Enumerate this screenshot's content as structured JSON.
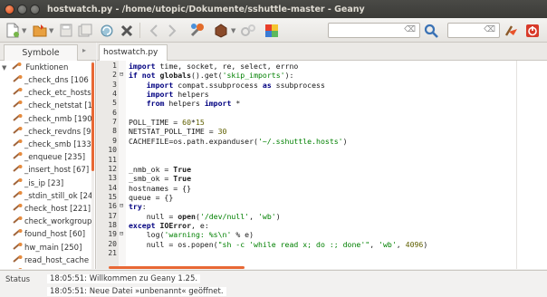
{
  "window": {
    "title": "hostwatch.py - /home/utopic/Dokumente/sshuttle-master - Geany"
  },
  "toolbar": {
    "buttons": [
      "new-file",
      "open-file",
      "save-file",
      "save-all",
      "revert",
      "close-file",
      "back",
      "forward",
      "compile",
      "build",
      "execute",
      "color-chooser"
    ],
    "search_value": "",
    "goto_value": "",
    "clear_glyph": "⌫"
  },
  "sidebar": {
    "tab_label": "Symbole",
    "root_label": "Funktionen",
    "items": [
      "_check_dns [106",
      "_check_etc_hosts",
      "_check_netstat [1",
      "_check_nmb [190",
      "_check_revdns [9",
      "_check_smb [133",
      "_enqueue [235]",
      "_insert_host [67]",
      "_is_ip [23]",
      "_stdin_still_ok [24",
      "check_host [221]",
      "check_workgroup",
      "found_host [60]",
      "hw_main [250]",
      "read_host_cache [",
      "write_host_cache"
    ]
  },
  "editor": {
    "tab_label": "hostwatch.py",
    "tab_close": "✖",
    "line_numbers": [
      "1",
      "2",
      "3",
      "4",
      "5",
      "6",
      "7",
      "8",
      "9",
      "10",
      "11",
      "12",
      "13",
      "14",
      "15",
      "16",
      "17",
      "18",
      "19",
      "20",
      "21"
    ],
    "lines": [
      "import time, socket, re, select, errno",
      "if not globals().get('skip_imports'):",
      "    import compat.ssubprocess as ssubprocess",
      "    import helpers",
      "    from helpers import *",
      "",
      "POLL_TIME = 60*15",
      "NETSTAT_POLL_TIME = 30",
      "CACHEFILE=os.path.expanduser('~/.sshuttle.hosts')",
      "",
      "",
      "_nmb_ok = True",
      "_smb_ok = True",
      "hostnames = {}",
      "queue = {}",
      "try:",
      "    null = open('/dev/null', 'wb')",
      "except IOError, e:",
      "    log('warning: %s\\n' % e)",
      "    null = os.popen(\"sh -c 'while read x; do :; done'\", 'wb', 4096)",
      ""
    ]
  },
  "messages": {
    "label": "Status",
    "lines": [
      "18:05:51: Willkommen zu Geany 1.25.",
      "18:05:51: Neue Datei »unbenannt« geöffnet."
    ]
  },
  "colors": {
    "accent": "#e86835",
    "titlebar": "#3b3b38",
    "keyword": "#000080",
    "string": "#008000"
  }
}
